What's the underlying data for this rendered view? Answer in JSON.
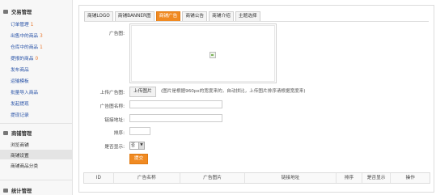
{
  "sidebar": {
    "trade": {
      "title": "交易管理",
      "items": [
        {
          "label": "订单管理",
          "count": "1"
        },
        {
          "label": "出售中的商品",
          "count": "3"
        },
        {
          "label": "仓库中的商品",
          "count": "1"
        },
        {
          "label": "提报的商品",
          "count": "0"
        },
        {
          "label": "发布商品"
        },
        {
          "label": "运输模板"
        },
        {
          "label": "批量导入商品"
        },
        {
          "label": "发起提现"
        },
        {
          "label": "提现记录"
        }
      ]
    },
    "shop": {
      "title": "商铺管理",
      "items": [
        {
          "label": "浏览商铺"
        },
        {
          "label": "商铺设置"
        },
        {
          "label": "商铺商品分类"
        }
      ]
    },
    "stats": {
      "title": "统计管理"
    }
  },
  "tabs": [
    "商铺LOGO",
    "商铺BANNER图",
    "商铺广告",
    "商铺公告",
    "商铺介绍",
    "主题选择"
  ],
  "active_tab": "商铺广告",
  "form": {
    "ad_image_label": "广告图:",
    "upload_label": "上传广告图:",
    "upload_button": "上传图片",
    "upload_hint": "(图片是根据960px的宽度来的，自动拼比，上传图片排序请根据宽度来)",
    "name_label": "广告图名称:",
    "name_value": "",
    "link_label": "链接地址:",
    "link_value": "",
    "order_label": "排序:",
    "order_value": "",
    "show_label": "是否显示:",
    "show_value": "否",
    "submit": "提交"
  },
  "table_headers": [
    "ID",
    "广告名称",
    "广告图片",
    "链接地址",
    "排序",
    "是否显示",
    "操作"
  ],
  "colors": {
    "accent": "#f08a22",
    "link": "#2a54a8",
    "count": "#e8742a"
  }
}
